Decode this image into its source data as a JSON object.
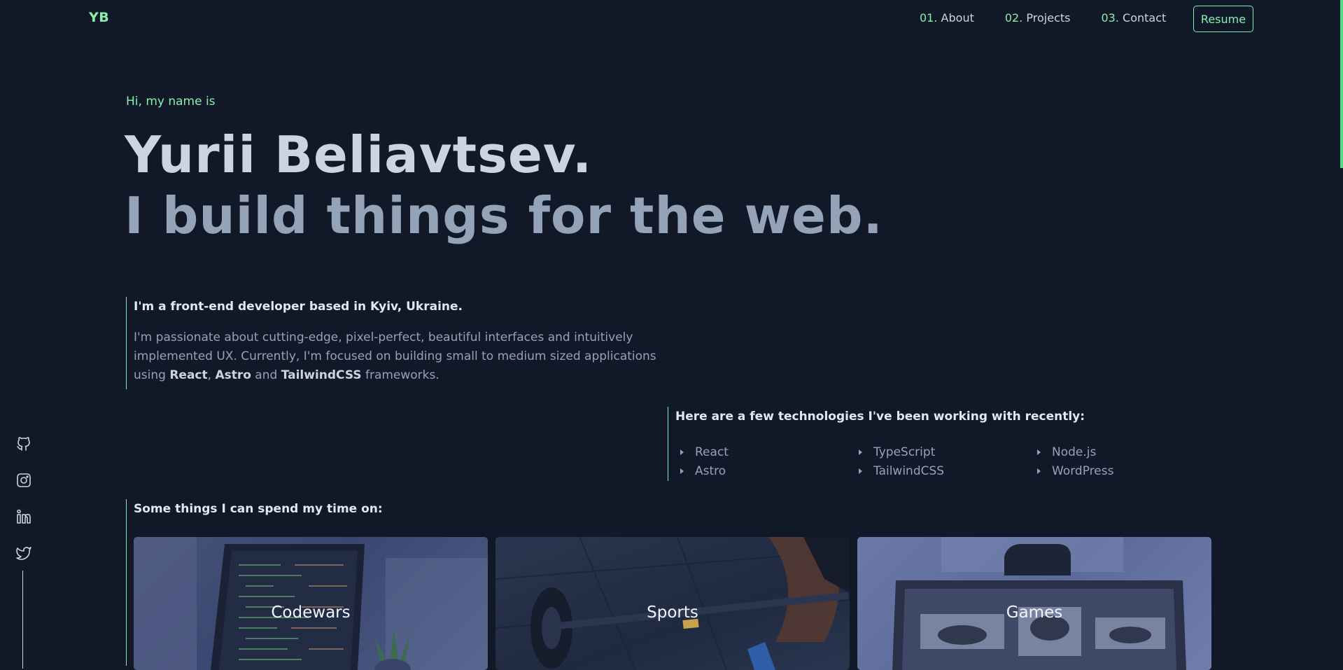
{
  "nav": {
    "logo": "YB",
    "links": [
      {
        "num": "01.",
        "label": "About"
      },
      {
        "num": "02.",
        "label": "Projects"
      },
      {
        "num": "03.",
        "label": "Contact"
      }
    ],
    "resume": "Resume"
  },
  "hero": {
    "intro": "Hi, my name is",
    "name": "Yurii Beliavtsev.",
    "tagline": "I build things for the web."
  },
  "bio": {
    "heading": "I'm a front-end developer based in Kyiv, Ukraine.",
    "text_part1": "I'm passionate about cutting-edge, pixel-perfect, beautiful interfaces and intuitively implemented UX. Currently, I'm focused on building small to medium sized applications using ",
    "fw1": "React",
    "sep1": ", ",
    "fw2": "Astro",
    "sep2": " and ",
    "fw3": "TailwindCSS",
    "text_part2": " frameworks."
  },
  "tech": {
    "heading": "Here are a few technologies I've been working with recently:",
    "items": [
      "React",
      "TypeScript",
      "Node.js",
      "Astro",
      "TailwindCSS",
      "WordPress"
    ]
  },
  "hobbies": {
    "heading": "Some things I can spend my time on:",
    "cards": [
      {
        "label": "Codewars"
      },
      {
        "label": "Sports"
      },
      {
        "label": "Games"
      }
    ]
  },
  "social": {
    "icons": [
      "github-icon",
      "instagram-icon",
      "linkedin-icon",
      "twitter-icon"
    ]
  },
  "colors": {
    "background": "#111827",
    "accent": "#86efac",
    "text": "#cbd5e1",
    "muted": "#94a3b8"
  }
}
